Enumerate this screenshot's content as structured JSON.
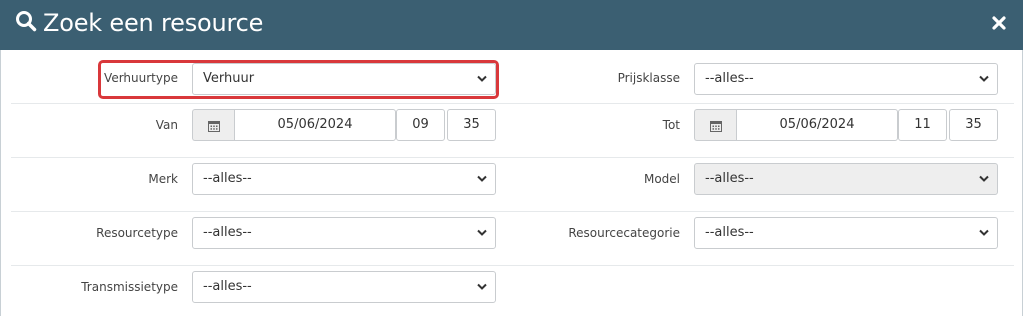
{
  "dialog": {
    "title": "Zoek een resource",
    "title_icon": "search-icon",
    "close_icon": "close-icon"
  },
  "fields": {
    "verhuurtype": {
      "label": "Verhuurtype",
      "value": "Verhuur"
    },
    "prijsklasse": {
      "label": "Prijsklasse",
      "value": "--alles--"
    },
    "van": {
      "label": "Van",
      "date": "05/06/2024",
      "hour": "09",
      "minute": "35"
    },
    "tot": {
      "label": "Tot",
      "date": "05/06/2024",
      "hour": "11",
      "minute": "35"
    },
    "merk": {
      "label": "Merk",
      "value": "--alles--"
    },
    "model": {
      "label": "Model",
      "value": "--alles--"
    },
    "resourcetype": {
      "label": "Resourcetype",
      "value": "--alles--"
    },
    "resourcecategorie": {
      "label": "Resourcecategorie",
      "value": "--alles--"
    },
    "transmissietype": {
      "label": "Transmissietype",
      "value": "--alles--"
    }
  },
  "colors": {
    "header_bg": "#3b5f72",
    "highlight": "#d9383b"
  }
}
